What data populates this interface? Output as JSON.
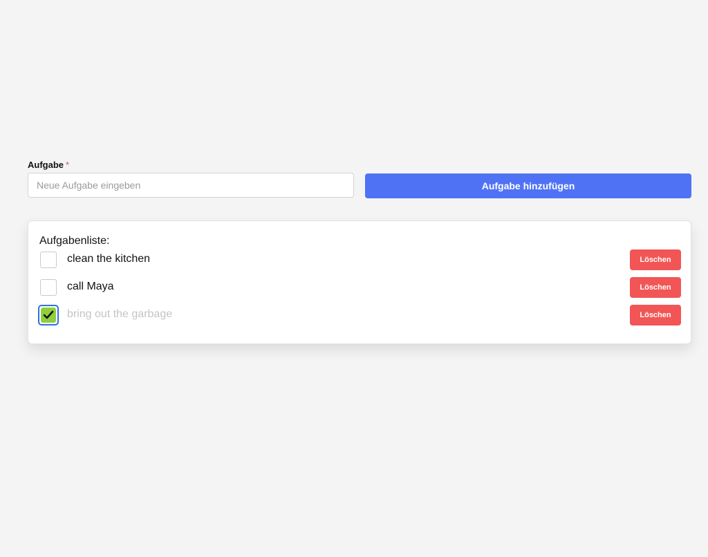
{
  "form": {
    "label": "Aufgabe",
    "required_marker": "*",
    "input_value": "",
    "input_placeholder": "Neue Aufgabe eingeben",
    "add_button_label": "Aufgabe hinzufügen"
  },
  "list": {
    "title": "Aufgabenliste:",
    "delete_label": "Löschen",
    "items": [
      {
        "text": "clean the kitchen",
        "done": false
      },
      {
        "text": "call Maya",
        "done": false
      },
      {
        "text": "bring out the garbage",
        "done": true
      }
    ]
  },
  "colors": {
    "background": "#f4f4f4",
    "primary": "#4f72f5",
    "danger": "#f25555",
    "check_fill": "#8fcf3c",
    "focus_ring": "#2f6fe0",
    "done_text": "#c4c4c4"
  },
  "icons": {
    "check": "check-icon"
  }
}
